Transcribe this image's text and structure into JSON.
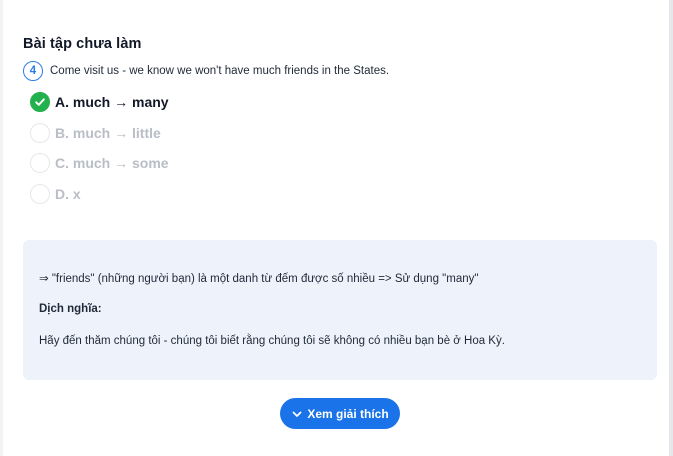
{
  "section": {
    "title": "Bài tập chưa làm"
  },
  "question": {
    "number": "4",
    "text": "Come visit us - we know we won't have much friends in the States."
  },
  "options": [
    {
      "label": "A. much → many",
      "state": "correct"
    },
    {
      "label": "B. much → little",
      "state": "unselected"
    },
    {
      "label": "C. much → some",
      "state": "unselected"
    },
    {
      "label": "D. x",
      "state": "unselected"
    }
  ],
  "explanation": {
    "line1": "⇒ \"friends\" (những người bạn) là một danh từ đếm được số nhiều => Sử dụng \"many\"",
    "heading": "Dịch nghĩa:",
    "translation": "Hãy đến thăm chúng tôi - chúng tôi biết rằng chúng tôi sẽ không có nhiều bạn bè ở Hoa Kỳ."
  },
  "button": {
    "label": "Xem giải thích",
    "icon": "chevron-down-icon"
  },
  "colors": {
    "accent": "#1a73e8",
    "correct": "#22b14c",
    "explain_bg": "#eef2fb"
  }
}
